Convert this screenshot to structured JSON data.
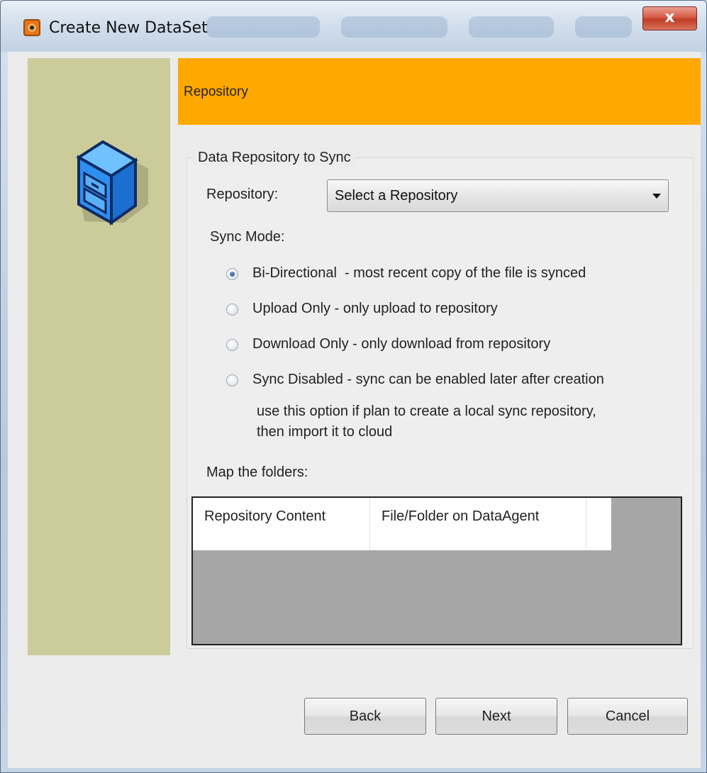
{
  "window": {
    "title": "Create New DataSet",
    "close_label": "x"
  },
  "banner": {
    "title": "Repository",
    "color": "#ffa800"
  },
  "side_panel": {
    "color": "#cccc9b",
    "icon": "repository-cube-icon"
  },
  "group": {
    "legend": "Data Repository to Sync",
    "repository_label": "Repository:",
    "repository_selected": "Select a Repository",
    "sync_mode_label": "Sync Mode:",
    "sync_options": [
      {
        "label": "Bi-Directional  - most recent copy of the file is synced",
        "checked": true
      },
      {
        "label": "Upload Only - only upload to repository",
        "checked": false
      },
      {
        "label": "Download Only - only download from repository",
        "checked": false
      },
      {
        "label": "Sync Disabled - sync can be enabled later after creation",
        "checked": false
      }
    ],
    "sync_disabled_note": "use this option if plan to create a local sync repository, then import it to cloud",
    "map_label": "Map the folders:",
    "table_columns": [
      "Repository Content",
      "File/Folder on DataAgent",
      ""
    ]
  },
  "buttons": {
    "back": "Back",
    "next": "Next",
    "cancel": "Cancel"
  }
}
